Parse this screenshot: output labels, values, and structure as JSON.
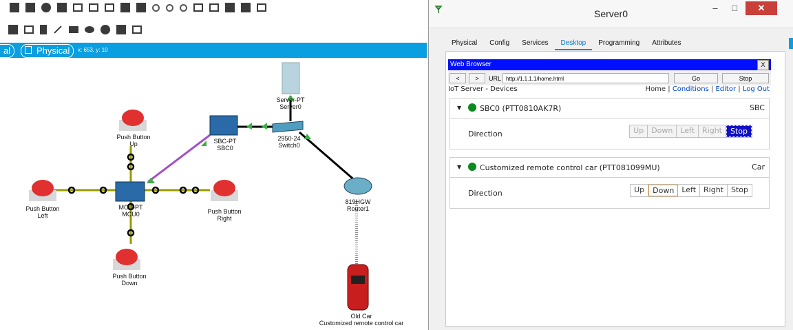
{
  "logical": {
    "mode_left": "al",
    "mode": "Physical",
    "coords": "x: 653, y: 10"
  },
  "devices": {
    "server": {
      "line1": "Server-PT",
      "line2": "Server0"
    },
    "sbc": {
      "line1": "SBC-PT",
      "line2": "SBC0"
    },
    "switch": {
      "line1": "2950-24",
      "line2": "Switch0"
    },
    "router": {
      "line1": "819HGW",
      "line2": "Router1"
    },
    "mcu": {
      "line1": "MCU-PT",
      "line2": "MCU0"
    },
    "btn_up": {
      "line1": "Push Button",
      "line2": "Up"
    },
    "btn_left": {
      "line1": "Push Button",
      "line2": "Left"
    },
    "btn_right": {
      "line1": "Push Button",
      "line2": "Right"
    },
    "btn_down": {
      "line1": "Push Button",
      "line2": "Down"
    },
    "car": {
      "line1": "Old Car",
      "line2": "Customized remote control car"
    }
  },
  "window": {
    "title": "Server0",
    "min": "–",
    "max": "□",
    "close": "✕",
    "tabs": [
      "Physical",
      "Config",
      "Services",
      "Desktop",
      "Programming",
      "Attributes"
    ],
    "active_tab": "Desktop"
  },
  "browser": {
    "title": "Web Browser",
    "close": "X",
    "back": "<",
    "forward": ">",
    "url_label": "URL",
    "url": "http://1.1.1.1/home.html",
    "go": "Go",
    "stop": "Stop"
  },
  "iot": {
    "page_title": "IoT Server - Devices",
    "nav": {
      "home": "Home",
      "conditions": "Conditions",
      "editor": "Editor",
      "logout": "Log Out",
      "sep": " | "
    },
    "devices": [
      {
        "name": "SBC0 (PTT0810AK7R)",
        "type": "SBC",
        "label": "Direction",
        "status_color": "#0b8a1e",
        "buttons": [
          "Up",
          "Down",
          "Left",
          "Right",
          "Stop"
        ],
        "active": "Stop"
      },
      {
        "name": "Customized remote control car (PTT081099MU)",
        "type": "Car",
        "label": "Direction",
        "status_color": "#0b8a1e",
        "buttons": [
          "Up",
          "Down",
          "Left",
          "Right",
          "Stop"
        ],
        "focused": "Down"
      }
    ]
  },
  "colors": {
    "link_green": "#3cb043",
    "cable_black": "#000000",
    "iot_purple": "#a050c8",
    "iot_olive": "#9a9a00"
  }
}
